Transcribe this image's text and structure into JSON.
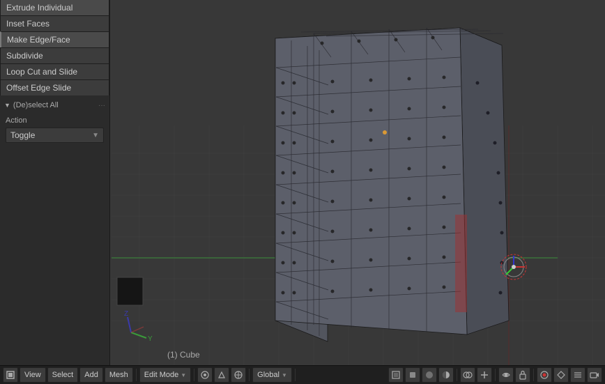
{
  "menu": {
    "items": [
      {
        "label": "Extrude Individual",
        "active": false
      },
      {
        "label": "Inset Faces",
        "active": false
      },
      {
        "label": "Make Edge/Face",
        "active": true
      },
      {
        "label": "Subdivide",
        "active": false
      },
      {
        "label": "Loop Cut and Slide",
        "active": false
      },
      {
        "label": "Offset Edge Slide",
        "active": false
      }
    ]
  },
  "section": {
    "label": "(De)select All",
    "handle": "···"
  },
  "action": {
    "label": "Action",
    "dropdown": {
      "value": "Toggle",
      "arrow": "▼"
    }
  },
  "statusbar": {
    "view_label": "View",
    "select_label": "Select",
    "add_label": "Add",
    "mesh_label": "Mesh",
    "mode_label": "Edit Mode",
    "mode_arrow": "▼",
    "pivot_arrow": "▼",
    "global_label": "Global",
    "global_arrow": "▼"
  },
  "scene": {
    "object_name": "(1) Cube"
  },
  "colors": {
    "bg": "#383838",
    "grid": "#3d3d3d",
    "panel": "#2b2b2b",
    "menu_item": "#3c3c3c",
    "active_dot": "#e8a030",
    "x_axis": "#cc3333",
    "y_axis": "#33cc33",
    "z_axis": "#3333cc"
  }
}
